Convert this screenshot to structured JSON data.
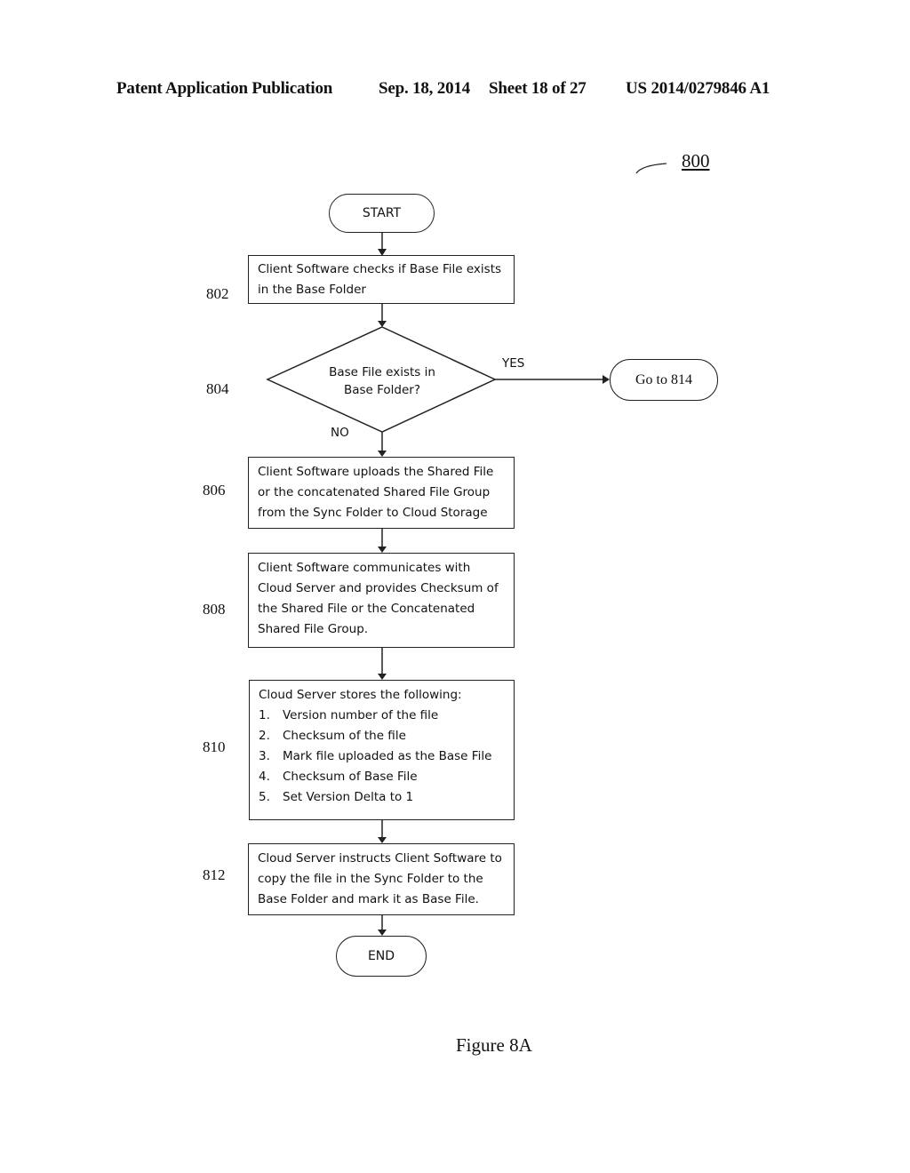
{
  "header": {
    "publication": "Patent Application Publication",
    "date": "Sep. 18, 2014",
    "sheet": "Sheet 18 of 27",
    "patent_number": "US 2014/0279846 A1"
  },
  "figure_ref": "800",
  "start_label": "START",
  "end_label": "END",
  "steps": {
    "s802": {
      "ref": "802",
      "lines": [
        "Client Software checks if Base File exists",
        "in the Base Folder"
      ]
    },
    "s804": {
      "ref": "804",
      "lines": [
        "Base File exists in",
        "Base Folder?"
      ],
      "yes_label": "YES",
      "no_label": "NO",
      "yes_target": "Go to 814"
    },
    "s806": {
      "ref": "806",
      "lines": [
        "Client Software uploads the Shared File",
        "or the concatenated Shared File Group",
        "from the Sync Folder to Cloud Storage"
      ]
    },
    "s808": {
      "ref": "808",
      "lines": [
        "Client Software communicates with",
        "Cloud Server and provides Checksum of",
        "the Shared File or the Concatenated",
        "Shared File Group."
      ]
    },
    "s810": {
      "ref": "810",
      "intro": "Cloud Server stores the following:",
      "items": [
        {
          "n": "1.",
          "text": "Version number of the file"
        },
        {
          "n": "2.",
          "text": "Checksum of the file"
        },
        {
          "n": "3.",
          "text": "Mark file uploaded as the Base File"
        },
        {
          "n": "4.",
          "text": "Checksum of Base File"
        },
        {
          "n": "5.",
          "text": "Set Version Delta to 1"
        }
      ]
    },
    "s812": {
      "ref": "812",
      "lines": [
        "Cloud Server instructs Client Software to",
        "copy the file in the Sync Folder to the",
        "Base Folder and mark it as Base File."
      ]
    }
  },
  "caption": "Figure 8A"
}
